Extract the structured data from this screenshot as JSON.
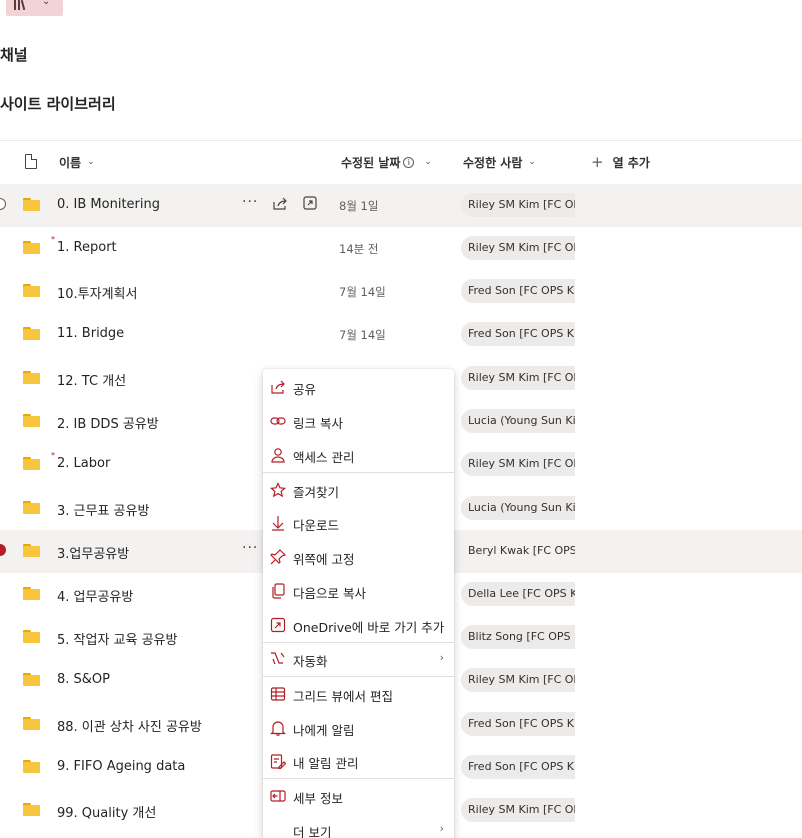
{
  "header": {
    "channel_title": "채널",
    "library_title": "사이트 라이브러리"
  },
  "columns": {
    "name": "이름",
    "modified": "수정된 날짜",
    "modified_by": "수정한 사람",
    "add_column": "열 추가"
  },
  "rows": [
    {
      "name": "0. IB Monitering",
      "date": "8월 1일",
      "modified_by": "Riley SM Kim [FC OPS"
    },
    {
      "name": "1. Report",
      "date": "14분 전",
      "modified_by": "Riley SM Kim [FC OPS"
    },
    {
      "name": "10.투자계획서",
      "date": "7월 14일",
      "modified_by": "Fred Son [FC OPS KKV"
    },
    {
      "name": "11. Bridge",
      "date": "7월 14일",
      "modified_by": "Fred Son [FC OPS KKV"
    },
    {
      "name": "12. TC 개선",
      "date": "",
      "modified_by": "Riley SM Kim [FC OPS"
    },
    {
      "name": "2. IB DDS 공유방",
      "date": "",
      "modified_by": "Lucia (Young Sun Kim"
    },
    {
      "name": "2. Labor",
      "date": "",
      "modified_by": "Riley SM Kim [FC OPS"
    },
    {
      "name": "3. 근무표 공유방",
      "date": "",
      "modified_by": "Lucia (Young Sun Kim"
    },
    {
      "name": "3.업무공유방",
      "date": "",
      "modified_by": "Beryl Kwak [FC OPS KI"
    },
    {
      "name": "4. 업무공유방",
      "date": "",
      "modified_by": "Della Lee [FC OPS KKV"
    },
    {
      "name": "5. 작업자 교육 공유방",
      "date": "",
      "modified_by": "Blitz Song [FC OPS IN"
    },
    {
      "name": "8. S&OP",
      "date": "",
      "modified_by": "Riley SM Kim [FC OPS"
    },
    {
      "name": "88. 이관 상차 사진 공유방",
      "date": "",
      "modified_by": "Fred Son [FC OPS KKV"
    },
    {
      "name": "9. FIFO Ageing data",
      "date": "",
      "modified_by": "Fred Son [FC OPS KKV"
    },
    {
      "name": "99. Quality 개선",
      "date": "",
      "modified_by": "Riley SM Kim [FC OPS"
    }
  ],
  "context_menu": {
    "share": "공유",
    "copy_link": "링크 복사",
    "manage_access": "액세스 관리",
    "favorite": "즐겨찾기",
    "download": "다운로드",
    "pin_top": "위쪽에 고정",
    "copy_to": "다음으로 복사",
    "onedrive_shortcut": "OneDrive에 바로 가기 추가",
    "automate": "자동화",
    "grid_edit": "그리드 뷰에서 편집",
    "alert_me": "나에게 알림",
    "manage_alerts": "내 알림 관리",
    "details": "세부 정보",
    "more": "더 보기"
  },
  "colors": {
    "accent": "#b31e25",
    "folder": "#f8c63c",
    "selected_row": "#f3f2f1",
    "library_button": "#f3d4d6"
  }
}
